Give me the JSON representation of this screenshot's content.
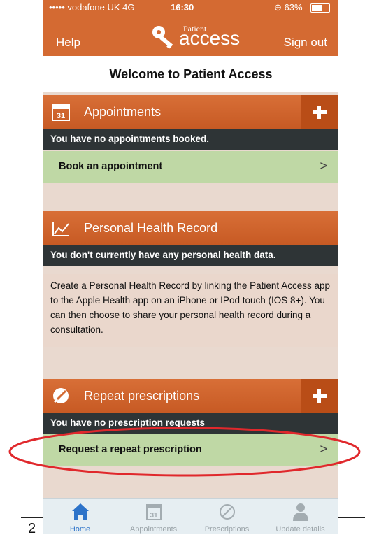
{
  "status": {
    "carrier": "••••• vodafone UK  4G",
    "time": "16:30",
    "battery": "63%"
  },
  "nav": {
    "help": "Help",
    "logo_small": "Patient",
    "logo_big": "access",
    "sign_out": "Sign out"
  },
  "welcome": "Welcome to Patient Access",
  "appointments": {
    "title": "Appointments",
    "notice": "You have no appointments booked.",
    "action": "Book an appointment",
    "calendar_day": "31"
  },
  "phr": {
    "title": "Personal Health Record",
    "notice": "You don't currently have any personal health data.",
    "body": "Create a Personal Health Record by linking the Patient Access app to the Apple Health app on an iPhone or IPod touch (IOS 8+). You can then choose to share your personal health record during a consultation."
  },
  "prescriptions": {
    "title": "Repeat prescriptions",
    "notice": "You have no prescription requests",
    "action": "Request a repeat prescription"
  },
  "tabs": [
    {
      "label": "Home",
      "icon": "home-icon",
      "active": true
    },
    {
      "label": "Appointments",
      "icon": "calendar-icon",
      "active": false
    },
    {
      "label": "Prescriptions",
      "icon": "pill-icon",
      "active": false
    },
    {
      "label": "Update details",
      "icon": "person-icon",
      "active": false
    }
  ],
  "page_number": "2",
  "colors": {
    "brand_orange": "#d46a32",
    "dark_bar": "#2e3436",
    "green_row": "#bfd8a5",
    "tab_active": "#2d73c9",
    "annotation_red": "#e0282c"
  }
}
